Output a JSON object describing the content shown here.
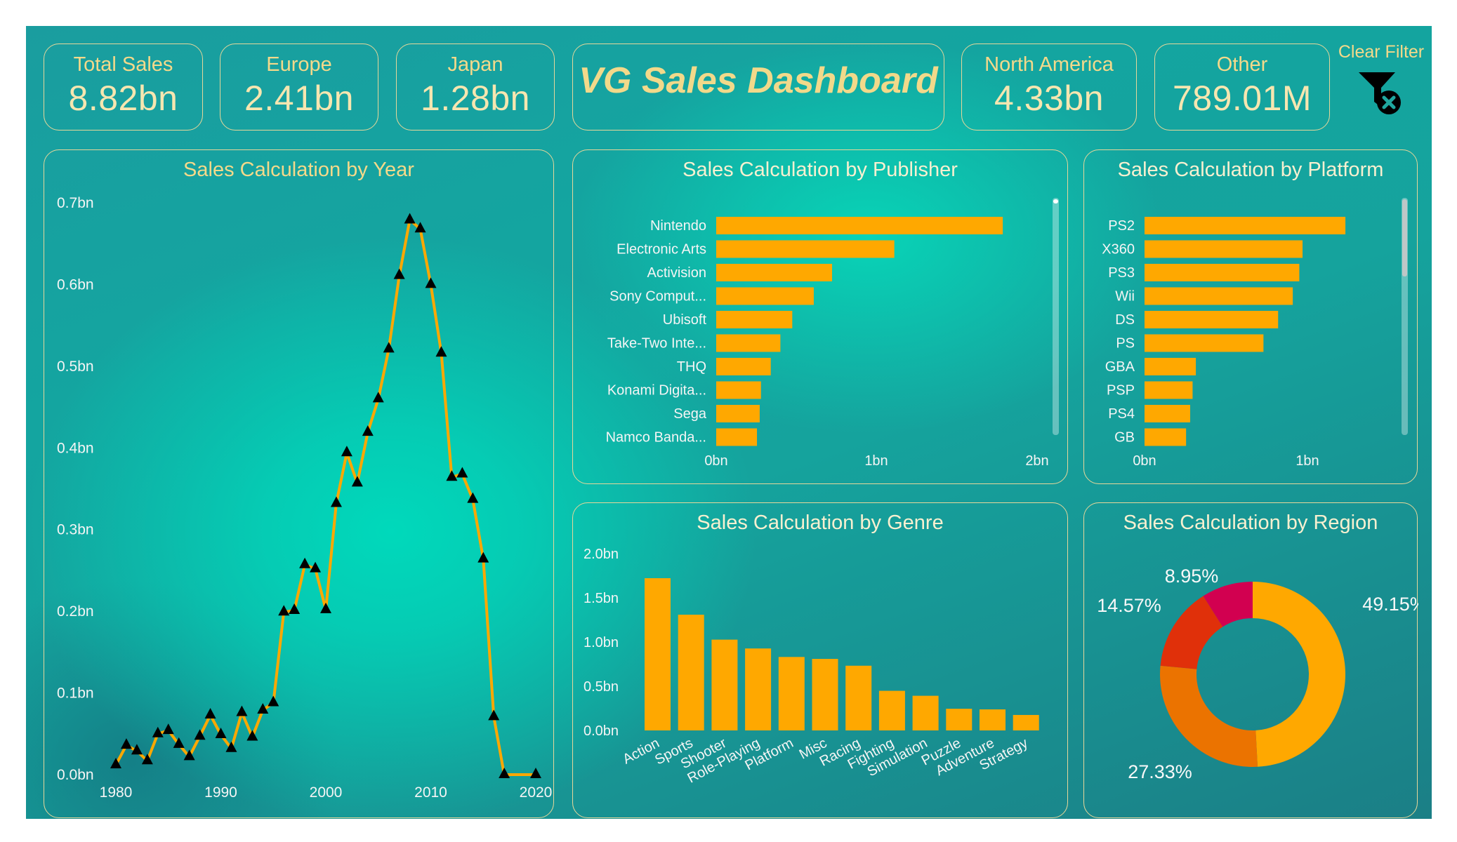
{
  "kpis": {
    "total_sales": {
      "label": "Total Sales",
      "value": "8.82bn"
    },
    "europe": {
      "label": "Europe",
      "value": "2.41bn"
    },
    "japan": {
      "label": "Japan",
      "value": "1.28bn"
    },
    "north_america": {
      "label": "North America",
      "value": "4.33bn"
    },
    "other": {
      "label": "Other",
      "value": "789.01M"
    }
  },
  "dashboard_title": "VG Sales Dashboard",
  "clear_filter": {
    "label": "Clear Filter",
    "icon": "filter-clear-icon"
  },
  "colors": {
    "accent": "#FFA800",
    "title_gold": "#F2D98A",
    "marker": "#000000"
  },
  "chart_data": [
    {
      "id": "year",
      "type": "line",
      "title": "Sales Calculation by Year",
      "x": [
        1980,
        1981,
        1982,
        1983,
        1984,
        1985,
        1986,
        1987,
        1988,
        1989,
        1990,
        1991,
        1992,
        1993,
        1994,
        1995,
        1996,
        1997,
        1998,
        1999,
        2000,
        2001,
        2002,
        2003,
        2004,
        2005,
        2006,
        2007,
        2008,
        2009,
        2010,
        2011,
        2012,
        2013,
        2014,
        2015,
        2016,
        2017,
        2020
      ],
      "values": [
        0.012,
        0.036,
        0.029,
        0.017,
        0.05,
        0.054,
        0.037,
        0.022,
        0.047,
        0.073,
        0.049,
        0.032,
        0.076,
        0.046,
        0.079,
        0.088,
        0.199,
        0.201,
        0.257,
        0.252,
        0.202,
        0.332,
        0.394,
        0.357,
        0.419,
        0.46,
        0.521,
        0.611,
        0.679,
        0.668,
        0.6,
        0.516,
        0.364,
        0.368,
        0.337,
        0.264,
        0.071,
        0.0,
        0.0
      ],
      "xticks": [
        "1980",
        "1990",
        "2000",
        "2010",
        "2020"
      ],
      "yticks": [
        "0.0bn",
        "0.1bn",
        "0.2bn",
        "0.3bn",
        "0.4bn",
        "0.5bn",
        "0.6bn",
        "0.7bn"
      ],
      "xlim": [
        1980,
        2020
      ],
      "ylim": [
        0,
        0.7
      ]
    },
    {
      "id": "publisher",
      "type": "bar",
      "orientation": "horizontal",
      "title": "Sales Calculation by Publisher",
      "categories": [
        "Nintendo",
        "Electronic Arts",
        "Activision",
        "Sony Comput...",
        "Ubisoft",
        "Take-Two Inte...",
        "THQ",
        "Konami Digita...",
        "Sega",
        "Namco Banda..."
      ],
      "values": [
        1.786,
        1.11,
        0.722,
        0.608,
        0.474,
        0.4,
        0.34,
        0.279,
        0.271,
        0.254
      ],
      "xticks": [
        "0bn",
        "1bn",
        "2bn"
      ],
      "xlim": [
        0,
        2
      ]
    },
    {
      "id": "platform",
      "type": "bar",
      "orientation": "horizontal",
      "title": "Sales Calculation by Platform",
      "categories": [
        "PS2",
        "X360",
        "PS3",
        "Wii",
        "DS",
        "PS",
        "GBA",
        "PSP",
        "PS4",
        "GB"
      ],
      "values": [
        1.233,
        0.97,
        0.95,
        0.91,
        0.82,
        0.73,
        0.315,
        0.295,
        0.28,
        0.255
      ],
      "xticks": [
        "0bn",
        "1bn"
      ],
      "xlim": [
        0,
        1.5
      ]
    },
    {
      "id": "genre",
      "type": "bar",
      "title": "Sales Calculation by Genre",
      "categories": [
        "Action",
        "Sports",
        "Shooter",
        "Role-Playing",
        "Platform",
        "Misc",
        "Racing",
        "Fighting",
        "Simulation",
        "Puzzle",
        "Adventure",
        "Strategy"
      ],
      "values": [
        1.722,
        1.309,
        1.027,
        0.927,
        0.831,
        0.809,
        0.732,
        0.448,
        0.392,
        0.245,
        0.238,
        0.175
      ],
      "yticks": [
        "0.0bn",
        "0.5bn",
        "1.0bn",
        "1.5bn",
        "2.0bn"
      ],
      "ylim": [
        0,
        2.0
      ]
    },
    {
      "id": "region",
      "type": "pie",
      "title": "Sales Calculation by Region",
      "labels": [
        "49.15%",
        "27.33%",
        "14.57%",
        "8.95%"
      ],
      "values": [
        49.15,
        27.33,
        14.57,
        8.95
      ],
      "colors": [
        "#FFA800",
        "#EB7300",
        "#E0300A",
        "#D20050"
      ]
    }
  ]
}
